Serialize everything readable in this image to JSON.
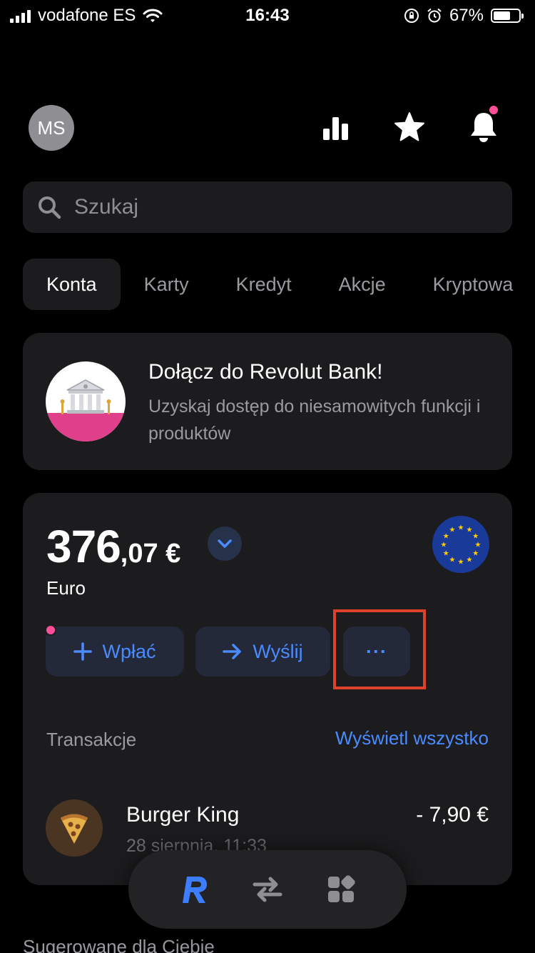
{
  "status_bar": {
    "carrier": "vodafone ES",
    "time": "16:43",
    "battery_percent": "67%",
    "battery_level": 0.67
  },
  "header": {
    "avatar_initials": "MS",
    "icons": [
      "analytics-icon",
      "star-icon",
      "bell-icon"
    ],
    "has_notification": true
  },
  "search": {
    "placeholder": "Szukaj"
  },
  "tabs": [
    {
      "label": "Konta",
      "active": true
    },
    {
      "label": "Karty",
      "active": false
    },
    {
      "label": "Kredyt",
      "active": false
    },
    {
      "label": "Akcje",
      "active": false
    },
    {
      "label": "Kryptowa",
      "active": false
    }
  ],
  "promo": {
    "title": "Dołącz do Revolut Bank!",
    "subtitle": "Uzyskaj dostęp do niesamowitych funkcji i produktów"
  },
  "account": {
    "balance_integer": "376",
    "balance_decimal": ",07 €",
    "currency_name": "Euro",
    "actions": {
      "deposit_label": "Wpłać",
      "send_label": "Wyślij",
      "more_label": "···"
    }
  },
  "transactions": {
    "header": "Transakcje",
    "view_all": "Wyświetl wszystko",
    "items": [
      {
        "merchant": "Burger King",
        "date": "28 sierpnia, 11:33",
        "amount": "- 7,90 €"
      }
    ]
  },
  "bottom_nav": [
    "revolut-logo-icon",
    "transfer-icon",
    "hub-icon"
  ],
  "suggested_header": "Sugerowane dla Ciebie",
  "colors": {
    "accent": "#4a8bff",
    "background": "#000000",
    "card": "#1c1c1e",
    "notification": "#ff4f9b",
    "highlight": "#e0412b"
  }
}
